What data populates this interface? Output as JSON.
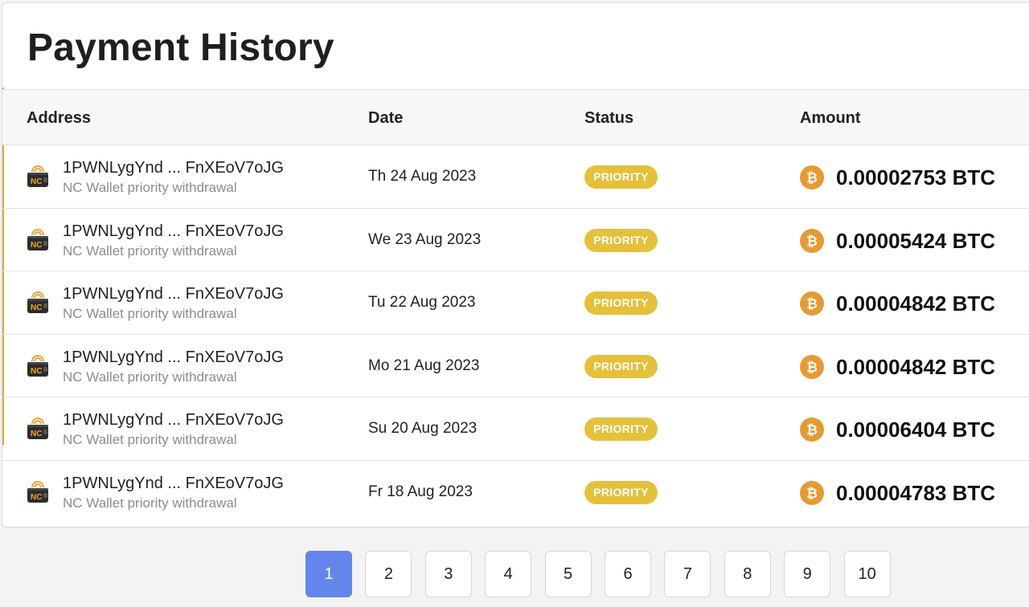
{
  "page_title": "Payment History",
  "table": {
    "headers": {
      "address": "Address",
      "date": "Date",
      "status": "Status",
      "amount": "Amount"
    },
    "rows": [
      {
        "address": "1PWNLygYnd ... FnXEoV7oJG",
        "description": "NC Wallet priority withdrawal",
        "date": "Th 24 Aug 2023",
        "status": "PRIORITY",
        "amount": "0.00002753 BTC"
      },
      {
        "address": "1PWNLygYnd ... FnXEoV7oJG",
        "description": "NC Wallet priority withdrawal",
        "date": "We 23 Aug 2023",
        "status": "PRIORITY",
        "amount": "0.00005424 BTC"
      },
      {
        "address": "1PWNLygYnd ... FnXEoV7oJG",
        "description": "NC Wallet priority withdrawal",
        "date": "Tu 22 Aug 2023",
        "status": "PRIORITY",
        "amount": "0.00004842 BTC"
      },
      {
        "address": "1PWNLygYnd ... FnXEoV7oJG",
        "description": "NC Wallet priority withdrawal",
        "date": "Mo 21 Aug 2023",
        "status": "PRIORITY",
        "amount": "0.00004842 BTC"
      },
      {
        "address": "1PWNLygYnd ... FnXEoV7oJG",
        "description": "NC Wallet priority withdrawal",
        "date": "Su 20 Aug 2023",
        "status": "PRIORITY",
        "amount": "0.00006404 BTC"
      },
      {
        "address": "1PWNLygYnd ... FnXEoV7oJG",
        "description": "NC Wallet priority withdrawal",
        "date": "Fr 18 Aug 2023",
        "status": "PRIORITY",
        "amount": "0.00004783 BTC"
      }
    ]
  },
  "icons": {
    "wallet": "nc-wallet-icon",
    "wallet_text": "NC",
    "coin": "bitcoin-icon"
  },
  "pagination": {
    "pages": [
      "1",
      "2",
      "3",
      "4",
      "5",
      "6",
      "7",
      "8",
      "9",
      "10"
    ],
    "current": "1"
  },
  "colors": {
    "priority_badge": "#e5c03a",
    "active_page": "#6486ec",
    "bitcoin": "#e69a33",
    "accent": "#e9a43a"
  }
}
